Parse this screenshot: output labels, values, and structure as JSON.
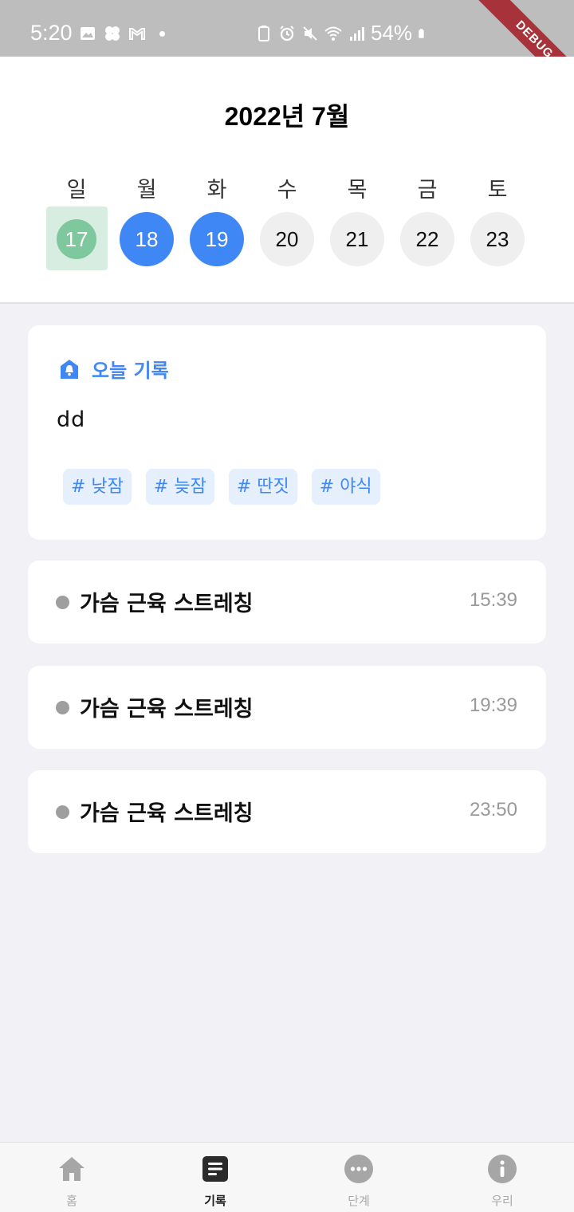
{
  "status_bar": {
    "time": "5:20",
    "battery": "54%"
  },
  "debug_banner": "DEBUG",
  "header": {
    "month_title": "2022년 7월",
    "days": [
      {
        "weekday": "일",
        "date": "17",
        "state": "today"
      },
      {
        "weekday": "월",
        "date": "18",
        "state": "done"
      },
      {
        "weekday": "화",
        "date": "19",
        "state": "done"
      },
      {
        "weekday": "수",
        "date": "20",
        "state": "future"
      },
      {
        "weekday": "목",
        "date": "21",
        "state": "future"
      },
      {
        "weekday": "금",
        "date": "22",
        "state": "future"
      },
      {
        "weekday": "토",
        "date": "23",
        "state": "future"
      }
    ]
  },
  "today_record": {
    "title": "오늘 기록",
    "icon": "house-bell-icon",
    "text": "dd",
    "tags": [
      "# 낮잠",
      "# 늦잠",
      "# 딴짓",
      "# 야식"
    ]
  },
  "records": [
    {
      "title": "가슴 근육 스트레칭",
      "time": "15:39"
    },
    {
      "title": "가슴 근육 스트레칭",
      "time": "19:39"
    },
    {
      "title": "가슴 근육 스트레칭",
      "time": "23:50"
    }
  ],
  "bottom_nav": [
    {
      "label": "홈",
      "icon": "home-icon",
      "active": false
    },
    {
      "label": "기록",
      "icon": "document-icon",
      "active": true
    },
    {
      "label": "단계",
      "icon": "more-dots-icon",
      "active": false
    },
    {
      "label": "우리",
      "icon": "info-icon",
      "active": false
    }
  ],
  "colors": {
    "accent": "#3f87f5",
    "today": "#7fc79c",
    "today_bg": "#d8ede2",
    "future": "#efefef",
    "page_bg": "#f1f1f6"
  }
}
